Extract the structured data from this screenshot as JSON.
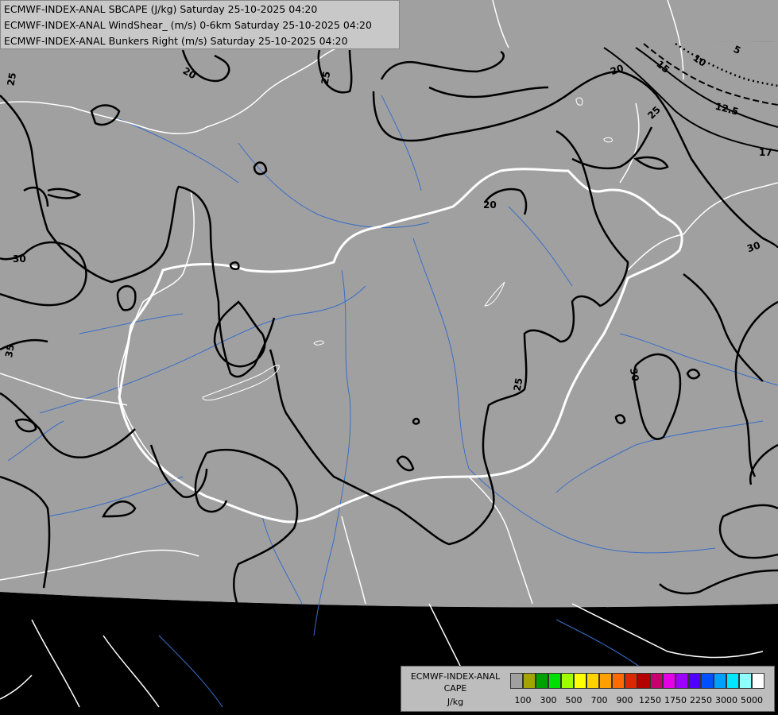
{
  "titles": {
    "line1": "ECMWF-INDEX-ANAL SBCAPE (J/kg) Saturday 25-10-2025 04:20",
    "line2": "ECMWF-INDEX-ANAL WindShear_ (m/s) 0-6km Saturday 25-10-2025 04:20",
    "line3": "ECMWF-INDEX-ANAL Bunkers Right (m/s) Saturday 25-10-2025 04:20"
  },
  "legend": {
    "title1": "ECMWF-INDEX-ANAL",
    "title2": "CAPE",
    "unit": "J/kg",
    "colors": [
      "#a0a0a0",
      "#a4a400",
      "#00a000",
      "#00e000",
      "#a0ff00",
      "#ffff00",
      "#ffd200",
      "#ffa000",
      "#ff6a00",
      "#dc2800",
      "#b40000",
      "#c8006e",
      "#e600e6",
      "#a000ff",
      "#5000ff",
      "#0050ff",
      "#00a0ff",
      "#00e6ff",
      "#90ffff",
      "#ffffff"
    ],
    "ticks": [
      "100",
      "300",
      "500",
      "700",
      "900",
      "1250",
      "1750",
      "2250",
      "3000",
      "5000"
    ]
  },
  "contour_labels": [
    "25",
    "20",
    "25",
    "15",
    "10",
    "5",
    "20",
    "12.5",
    "25",
    "17",
    "30",
    "30",
    "20",
    "35",
    "25",
    "30"
  ],
  "map": {
    "background_color": "#000000",
    "domain_color": "#a0a0a0",
    "border_color": "#ffffff",
    "river_color": "#3a6ec8",
    "contour_color": "#000000"
  }
}
